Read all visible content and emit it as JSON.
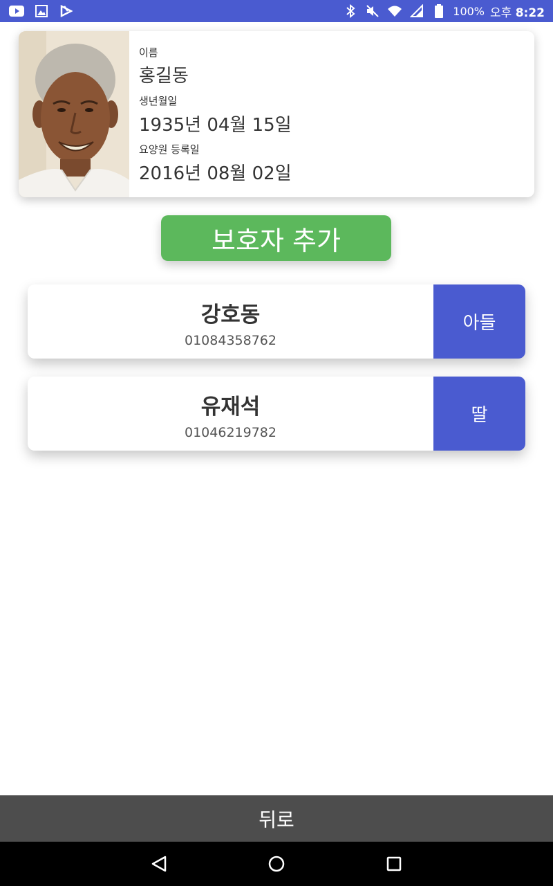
{
  "status_bar": {
    "left_icons": [
      "youtube-icon",
      "image-icon",
      "app-icon"
    ],
    "right_icons": [
      "bluetooth-icon",
      "mute-icon",
      "wifi-icon",
      "signal-icon",
      "battery-icon"
    ],
    "battery": "100%",
    "time_prefix": "오후",
    "time": "8:22",
    "bar_color": "#4a5bd0"
  },
  "profile": {
    "photo_icon": "elderly-man-photo",
    "name_label": "이름",
    "name": "홍길동",
    "birth_label": "생년월일",
    "birth": "1935년 04월 15일",
    "register_label": "요양원 등록일",
    "register_date": "2016년 08월 02일"
  },
  "add_button": {
    "label": "보호자 추가",
    "color": "#5cb85c"
  },
  "guardians": [
    {
      "name": "강호동",
      "phone": "01084358762",
      "relation": "아들"
    },
    {
      "name": "유재석",
      "phone": "01046219782",
      "relation": "딸"
    }
  ],
  "accent_color": "#4a5bd0",
  "back_button": {
    "label": "뒤로"
  },
  "nav_bar": {
    "buttons": [
      "back-triangle-icon",
      "home-circle-icon",
      "recents-square-icon"
    ]
  }
}
